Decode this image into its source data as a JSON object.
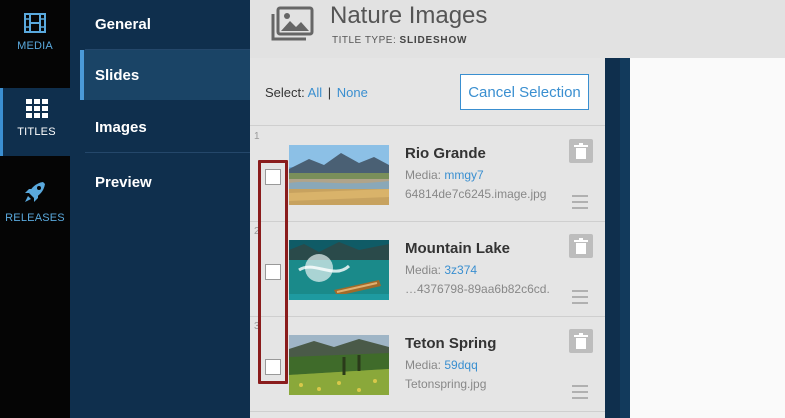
{
  "rail": {
    "items": [
      {
        "label": "MEDIA",
        "icon": "film-icon"
      },
      {
        "label": "TITLES",
        "icon": "grid-icon",
        "active": true
      },
      {
        "label": "RELEASES",
        "icon": "rocket-icon"
      }
    ]
  },
  "subnav": {
    "items": [
      {
        "label": "General"
      },
      {
        "label": "Slides",
        "active": true
      },
      {
        "label": "Images"
      },
      {
        "label": "Preview"
      }
    ]
  },
  "header": {
    "title": "Nature Images",
    "type_label": "TITLE TYPE:",
    "type_value": "SLIDESHOW",
    "icon": "images-icon"
  },
  "selection": {
    "label": "Select:",
    "all": "All",
    "separator": "|",
    "none": "None",
    "cancel_label": "Cancel Selection"
  },
  "slides": [
    {
      "number": "1",
      "name": "Rio Grande",
      "media_label": "Media:",
      "media_id": "mmgy7",
      "file": "64814de7c6245.image.jpg",
      "checked": false
    },
    {
      "number": "2",
      "name": "Mountain Lake",
      "media_label": "Media:",
      "media_id": "3z374",
      "file": "…4376798-89aa6b82c6cd.",
      "checked": false
    },
    {
      "number": "3",
      "name": "Teton Spring",
      "media_label": "Media:",
      "media_id": "59dqq",
      "file": "Tetonspring.jpg",
      "checked": false
    }
  ],
  "colors": {
    "accent": "#3a8fd0",
    "nav_bg": "#0f2f4d",
    "rail_bg": "#050505",
    "highlight": "#8a1c1c"
  }
}
